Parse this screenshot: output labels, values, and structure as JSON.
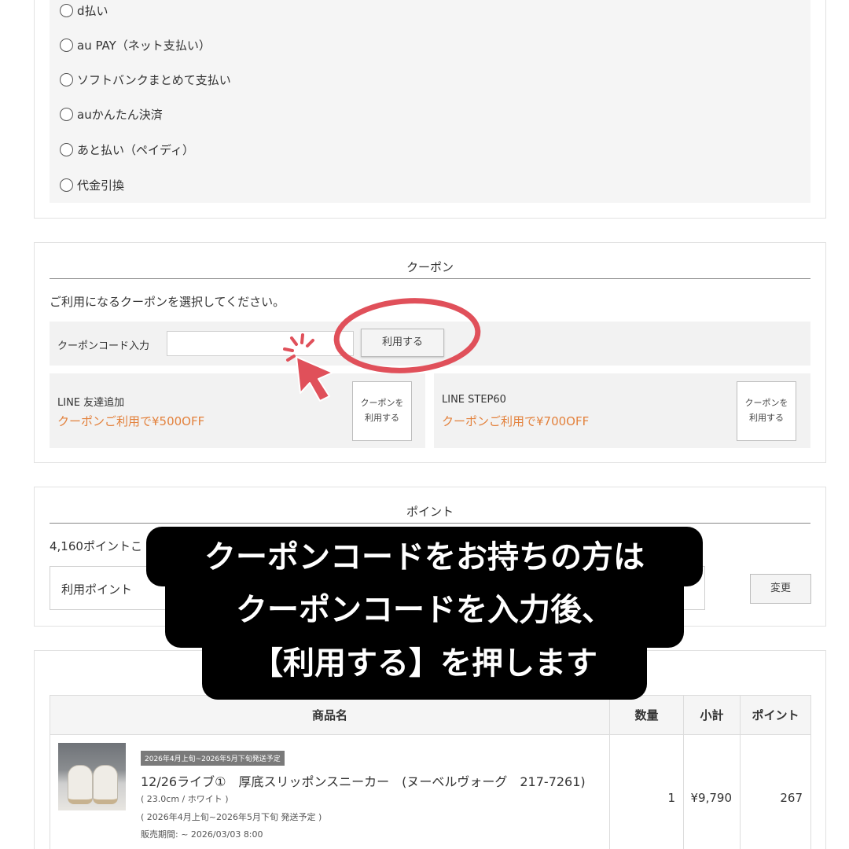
{
  "payment": {
    "options": [
      "d払い",
      "au PAY（ネット支払い）",
      "ソフトバンクまとめて支払い",
      "auかんたん決済",
      "あと払い（ペイディ）",
      "代金引換"
    ]
  },
  "coupon": {
    "title": "クーポン",
    "instruction": "ご利用になるクーポンを選択してください。",
    "code_label": "クーポンコード入力",
    "code_value": "",
    "apply_label": "利用する",
    "cards": [
      {
        "name": "LINE 友達追加",
        "desc": "クーポンご利用で¥500OFF",
        "button": "クーポンを\n利用する"
      },
      {
        "name": "LINE STEP60",
        "desc": "クーポンご利用で¥700OFF",
        "button": "クーポンを\n利用する"
      }
    ]
  },
  "points": {
    "title": "ポイント",
    "available": "4,160ポイントこ",
    "input_label": "利用ポイント",
    "change_label": "変更"
  },
  "order": {
    "headers": [
      "商品名",
      "数量",
      "小計",
      "ポイント"
    ],
    "item": {
      "badge": "2026年4月上旬~2026年5月下旬発送予定",
      "name": "12/26ライブ①　厚底スリッポンスニーカー　(ヌーベルヴォーグ　217-7261)",
      "variant": "( 23.0cm / ホワイト )",
      "ship": "( 2026年4月上旬~2026年5月下旬 発送予定 )",
      "sale_period": "販売期間: ~ 2026/03/03 8:00",
      "qty": "1",
      "subtotal": "¥9,790",
      "points": "267"
    }
  },
  "overlay": {
    "lines": [
      "クーポンコードをお持ちの方は",
      "クーポンコードを入力後、",
      "【利用する】を押します"
    ]
  },
  "colors": {
    "annotation": "#e0505a",
    "coupon_accent": "#e3813c"
  }
}
